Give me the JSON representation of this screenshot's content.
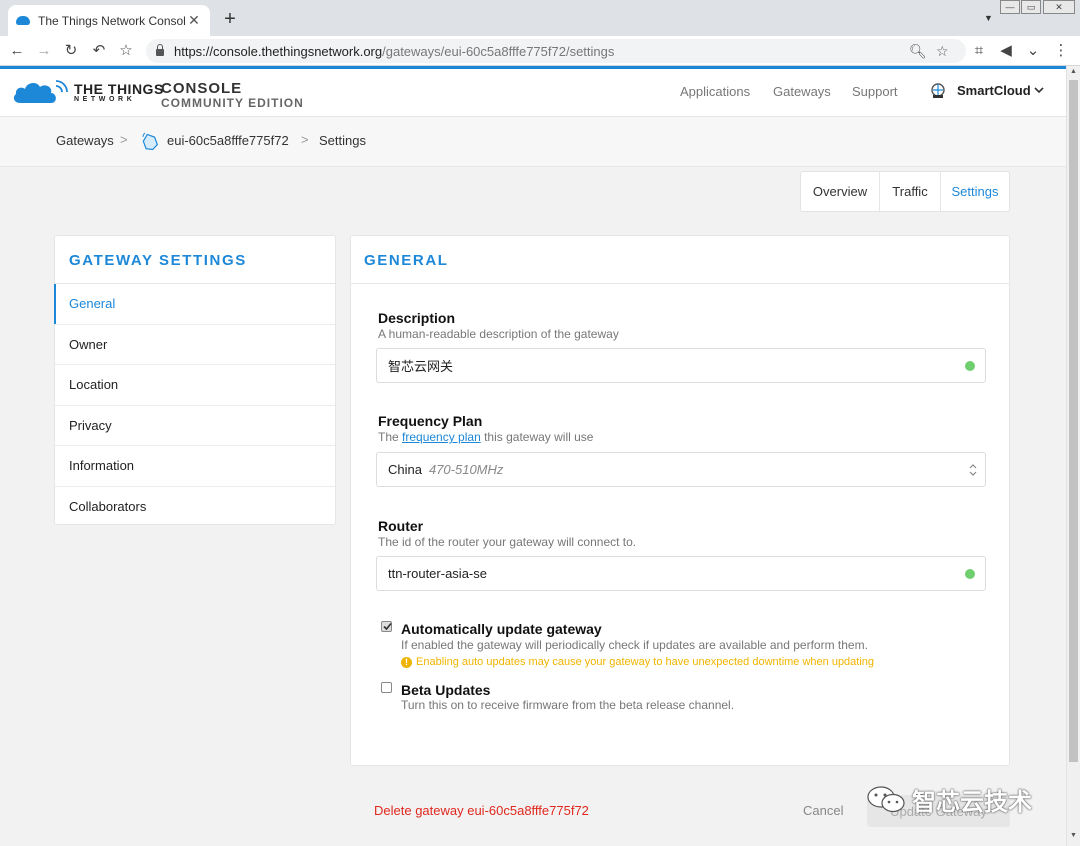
{
  "browser": {
    "tab_title": "The Things Network Console",
    "tab_close": "✕",
    "new_tab": "+",
    "url_host": "https://console.thethingsnetwork.org",
    "url_path": "/gateways/eui-60c5a8fffe775f72/settings"
  },
  "header": {
    "logo_line1": "THE THINGS",
    "logo_line2": "NETWORK",
    "console_line1": "CONSOLE",
    "console_line2": "COMMUNITY EDITION",
    "nav": [
      "Applications",
      "Gateways",
      "Support"
    ],
    "user_name": "SmartCloud"
  },
  "breadcrumb": {
    "root": "Gateways",
    "gateway": "eui-60c5a8fffe775f72",
    "current": "Settings",
    "sep": ">"
  },
  "tabs": [
    "Overview",
    "Traffic",
    "Settings"
  ],
  "sidebar": {
    "title": "GATEWAY SETTINGS",
    "items": [
      "General",
      "Owner",
      "Location",
      "Privacy",
      "Information",
      "Collaborators"
    ]
  },
  "general": {
    "title": "GENERAL",
    "description": {
      "label": "Description",
      "help": "A human-readable description of the gateway",
      "value": "智芯云网关"
    },
    "frequency_plan": {
      "label": "Frequency Plan",
      "help_prefix": "The ",
      "help_link": "frequency plan",
      "help_suffix": " this gateway will use",
      "value": "China",
      "value_sub": "470-510MHz"
    },
    "router": {
      "label": "Router",
      "help": "The id of the router your gateway will connect to.",
      "value": "ttn-router-asia-se"
    },
    "auto_update": {
      "label": "Automatically update gateway",
      "help": "If enabled the gateway will periodically check if updates are available and perform them.",
      "warning": "Enabling auto updates may cause your gateway to have unexpected downtime when updating",
      "checked": true
    },
    "beta_updates": {
      "label": "Beta Updates",
      "help": "Turn this on to receive firmware from the beta release channel.",
      "checked": false
    }
  },
  "footer": {
    "delete_label": "Delete gateway eui-60c5a8fffe775f72",
    "cancel_label": "Cancel",
    "update_label": "Update Gateway"
  },
  "watermark": {
    "text": "智芯云技术"
  },
  "colors": {
    "accent": "#1e88d8",
    "danger": "#e0281e",
    "warning": "#f0b400",
    "success": "#6fcf6f"
  }
}
